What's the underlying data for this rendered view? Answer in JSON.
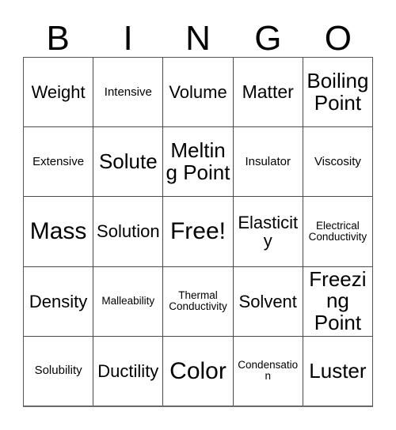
{
  "card": {
    "title_letters": [
      "B",
      "I",
      "N",
      "G",
      "O"
    ],
    "background_color": "#ffffff",
    "text_color": "#000000",
    "border_color": "#4a4a4a"
  },
  "grid": {
    "columns": 5,
    "rows": 5,
    "free_space": "Free!",
    "cells": [
      [
        {
          "label": "Weight",
          "size": "t-md"
        },
        {
          "label": "Intensive",
          "size": "t-sm"
        },
        {
          "label": "Volume",
          "size": "t-md"
        },
        {
          "label": "Matter",
          "size": "t-mdw"
        },
        {
          "label": "Boiling Point",
          "size": "t-lg"
        }
      ],
      [
        {
          "label": "Extensive",
          "size": "t-sm"
        },
        {
          "label": "Solute",
          "size": "t-lg"
        },
        {
          "label": "Melting Point",
          "size": "t-lg"
        },
        {
          "label": "Insulator",
          "size": "t-sm"
        },
        {
          "label": "Viscosity",
          "size": "t-sm"
        }
      ],
      [
        {
          "label": "Mass",
          "size": "t-xl"
        },
        {
          "label": "Solution",
          "size": "t-md"
        },
        {
          "label": "Free!",
          "size": "t-xl"
        },
        {
          "label": "Elasticity",
          "size": "t-md"
        },
        {
          "label": "Electrical Conductivity",
          "size": "t-xs"
        }
      ],
      [
        {
          "label": "Density",
          "size": "t-md"
        },
        {
          "label": "Malleability",
          "size": "t-xs"
        },
        {
          "label": "Thermal Conductivity",
          "size": "t-xs"
        },
        {
          "label": "Solvent",
          "size": "t-md"
        },
        {
          "label": "Freezing Point",
          "size": "t-lg"
        }
      ],
      [
        {
          "label": "Solubility",
          "size": "t-sm"
        },
        {
          "label": "Ductility",
          "size": "t-md"
        },
        {
          "label": "Color",
          "size": "t-xl"
        },
        {
          "label": "Condensation",
          "size": "t-xs"
        },
        {
          "label": "Luster",
          "size": "t-lg"
        }
      ]
    ]
  }
}
